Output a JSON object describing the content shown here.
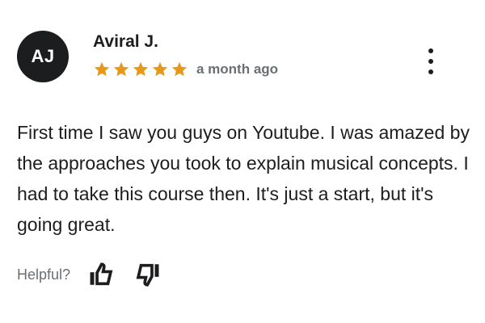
{
  "review": {
    "avatar_initials": "AJ",
    "reviewer_name": "Aviral J.",
    "rating": 5,
    "rating_max": 5,
    "star_color": "#e59819",
    "date": "a month ago",
    "text": "First time I saw you guys on Youtube. I was amazed by the approaches you took to explain musical concepts. I had to take this course then. It's just a start, but it's going great."
  },
  "actions": {
    "more_icon": "more-vertical-icon",
    "helpful_label": "Helpful?",
    "thumbs_up_icon": "thumbs-up-icon",
    "thumbs_down_icon": "thumbs-down-icon"
  }
}
